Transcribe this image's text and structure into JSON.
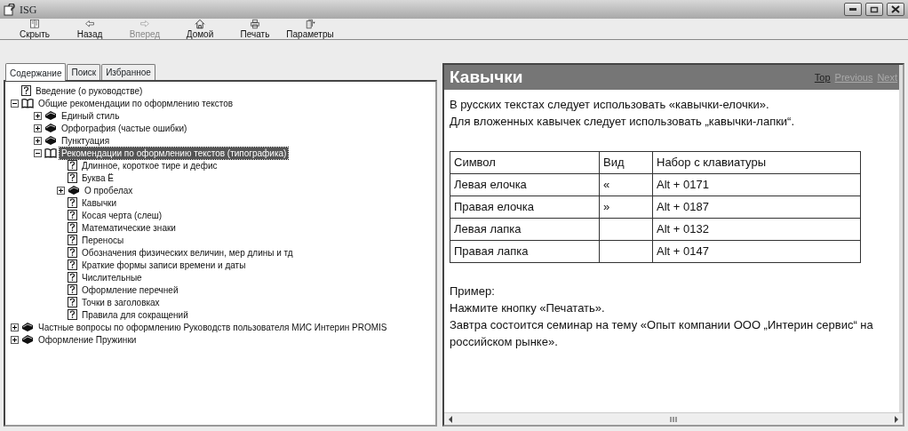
{
  "window": {
    "title": "ISG"
  },
  "toolbar": [
    {
      "label": "Скрыть",
      "disabled": false
    },
    {
      "label": "Назад",
      "disabled": false
    },
    {
      "label": "Вперед",
      "disabled": true
    },
    {
      "label": "Домой",
      "disabled": false
    },
    {
      "label": "Печать",
      "disabled": false
    },
    {
      "label": "Параметры",
      "disabled": false
    }
  ],
  "tabs": [
    {
      "label": "Содержание",
      "selected": true
    },
    {
      "label": "Поиск",
      "selected": false
    },
    {
      "label": "Избранное",
      "selected": false
    }
  ],
  "tree": [
    {
      "kind": "topic",
      "label": "Введение (о руководстве)",
      "selected": false
    },
    {
      "kind": "book",
      "label": "Общие рекомендации по оформлению текстов",
      "expanded": true,
      "selected": false,
      "children": [
        {
          "kind": "book",
          "label": "Единый стиль",
          "expanded": false,
          "selected": false
        },
        {
          "kind": "book",
          "label": "Орфография (частые ошибки)",
          "expanded": false,
          "selected": false
        },
        {
          "kind": "book",
          "label": "Пунктуация",
          "expanded": false,
          "selected": false
        },
        {
          "kind": "book",
          "label": "Рекомендации по оформлению текстов (типографика)",
          "expanded": true,
          "selected": true,
          "children": [
            {
              "kind": "topic",
              "label": "Длинное, короткое тире и дефис",
              "selected": false
            },
            {
              "kind": "topic",
              "label": "Буква Ё",
              "selected": false
            },
            {
              "kind": "book",
              "label": "О пробелах",
              "expanded": false,
              "selected": false
            },
            {
              "kind": "topic",
              "label": "Кавычки",
              "selected": false
            },
            {
              "kind": "topic",
              "label": "Косая черта (слеш)",
              "selected": false
            },
            {
              "kind": "topic",
              "label": "Математические знаки",
              "selected": false
            },
            {
              "kind": "topic",
              "label": "Переносы",
              "selected": false
            },
            {
              "kind": "topic",
              "label": "Обозначения физических величин, мер длины и тд",
              "selected": false
            },
            {
              "kind": "topic",
              "label": "Краткие формы записи времени и даты",
              "selected": false
            },
            {
              "kind": "topic",
              "label": "Числительные",
              "selected": false
            },
            {
              "kind": "topic",
              "label": "Оформление перечней",
              "selected": false
            },
            {
              "kind": "topic",
              "label": "Точки в заголовках",
              "selected": false
            },
            {
              "kind": "topic",
              "label": "Правила для сокращений",
              "selected": false
            }
          ]
        }
      ]
    },
    {
      "kind": "book",
      "label": "Частные вопросы по оформлению Руководств пользователя МИС Интерин PROMIS",
      "expanded": false,
      "selected": false
    },
    {
      "kind": "book",
      "label": "Оформление Пружинки",
      "expanded": false,
      "selected": false
    }
  ],
  "topic": {
    "title": "Кавычки",
    "nav": [
      {
        "label": "Top",
        "disabled": false
      },
      {
        "label": "Previous",
        "disabled": true
      },
      {
        "label": "Next",
        "disabled": true
      }
    ],
    "intro": [
      "В русских текстах следует использовать «кавычки-елочки».",
      "Для вложенных кавычек следует использовать „кавычки-лапки“."
    ],
    "table": {
      "columns": [
        "Символ",
        "Вид",
        "Набор с клавиатуры"
      ],
      "rows": [
        [
          "Левая елочка",
          "«",
          "Alt + 0171"
        ],
        [
          "Правая елочка",
          "»",
          "Alt + 0187"
        ],
        [
          "Левая лапка",
          "",
          "Alt + 0132"
        ],
        [
          "Правая лапка",
          "",
          "Alt + 0147"
        ]
      ]
    },
    "example": [
      "Пример:",
      "Нажмите кнопку «Печатать».",
      "Завтра состоится семинар на тему «Опыт компании ООО „Интерин сервис“ на российском рынке»."
    ]
  }
}
